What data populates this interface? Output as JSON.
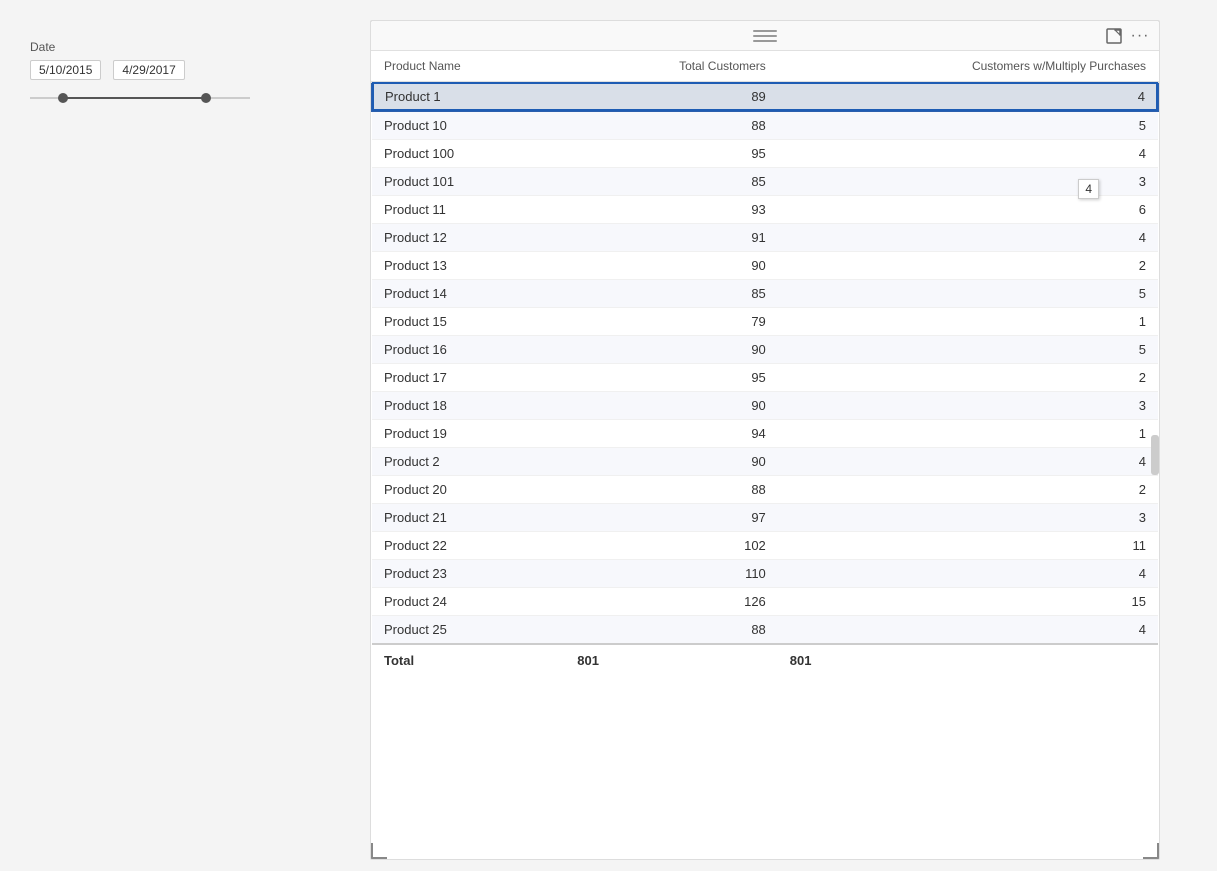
{
  "date_filter": {
    "label": "Date",
    "start_date": "5/10/2015",
    "end_date": "4/29/2017"
  },
  "table": {
    "columns": [
      {
        "id": "product_name",
        "label": "Product Name"
      },
      {
        "id": "total_customers",
        "label": "Total Customers"
      },
      {
        "id": "customers_multiply",
        "label": "Customers w/Multiply Purchases"
      }
    ],
    "rows": [
      {
        "product_name": "Product 1",
        "total_customers": 89,
        "customers_multiply": 4,
        "selected": true
      },
      {
        "product_name": "Product 10",
        "total_customers": 88,
        "customers_multiply": 5
      },
      {
        "product_name": "Product 100",
        "total_customers": 95,
        "customers_multiply": 4
      },
      {
        "product_name": "Product 101",
        "total_customers": 85,
        "customers_multiply": 3
      },
      {
        "product_name": "Product 11",
        "total_customers": 93,
        "customers_multiply": 6
      },
      {
        "product_name": "Product 12",
        "total_customers": 91,
        "customers_multiply": 4
      },
      {
        "product_name": "Product 13",
        "total_customers": 90,
        "customers_multiply": 2
      },
      {
        "product_name": "Product 14",
        "total_customers": 85,
        "customers_multiply": 5
      },
      {
        "product_name": "Product 15",
        "total_customers": 79,
        "customers_multiply": 1
      },
      {
        "product_name": "Product 16",
        "total_customers": 90,
        "customers_multiply": 5
      },
      {
        "product_name": "Product 17",
        "total_customers": 95,
        "customers_multiply": 2
      },
      {
        "product_name": "Product 18",
        "total_customers": 90,
        "customers_multiply": 3
      },
      {
        "product_name": "Product 19",
        "total_customers": 94,
        "customers_multiply": 1
      },
      {
        "product_name": "Product 2",
        "total_customers": 90,
        "customers_multiply": 4
      },
      {
        "product_name": "Product 20",
        "total_customers": 88,
        "customers_multiply": 2
      },
      {
        "product_name": "Product 21",
        "total_customers": 97,
        "customers_multiply": 3
      },
      {
        "product_name": "Product 22",
        "total_customers": 102,
        "customers_multiply": 11
      },
      {
        "product_name": "Product 23",
        "total_customers": 110,
        "customers_multiply": 4
      },
      {
        "product_name": "Product 24",
        "total_customers": 126,
        "customers_multiply": 15
      },
      {
        "product_name": "Product 25",
        "total_customers": 88,
        "customers_multiply": 4
      }
    ],
    "total": {
      "label": "Total",
      "total_customers": 801,
      "customers_multiply": 801
    }
  },
  "tooltip": {
    "value": "4"
  },
  "icons": {
    "hamburger": "≡",
    "expand": "⤢",
    "ellipsis": "···"
  }
}
